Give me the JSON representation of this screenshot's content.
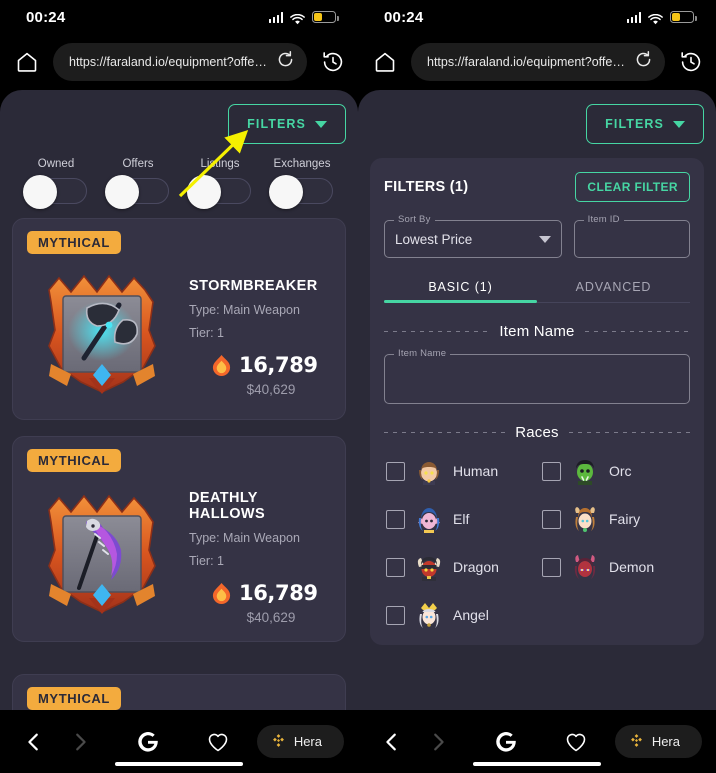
{
  "status_bar": {
    "time": "00:24",
    "signal_icon": "cellular-bars-icon",
    "wifi_icon": "wifi-icon",
    "battery_icon": "battery-low-icon"
  },
  "browser": {
    "home_icon": "home-icon",
    "url": "https://faraland.io/equipment?offer...",
    "reload_icon": "reload-icon",
    "history_icon": "history-icon"
  },
  "left_pane": {
    "filters_button": {
      "label": "FILTERS",
      "caret_icon": "chevron-down-icon",
      "accent": "#46d6a3"
    },
    "toggles": [
      {
        "label": "Owned",
        "state": "off"
      },
      {
        "label": "Offers",
        "state": "off"
      },
      {
        "label": "Listings",
        "state": "off"
      },
      {
        "label": "Exchanges",
        "state": "off"
      }
    ],
    "items": [
      {
        "rarity": "MYTHICAL",
        "name": "STORMBREAKER",
        "type": "Type: Main Weapon",
        "tier": "Tier: 1",
        "price": "16,789",
        "usd": "$40,629",
        "currency_icon": "flame-token-icon",
        "art": "stormbreaker-axe"
      },
      {
        "rarity": "MYTHICAL",
        "name": "DEATHLY HALLOWS",
        "type": "Type: Main Weapon",
        "tier": "Tier: 1",
        "price": "16,789",
        "usd": "$40,629",
        "currency_icon": "flame-token-icon",
        "art": "deathly-hallows-scythe"
      }
    ],
    "annotation": {
      "type": "arrow",
      "color": "#f5f000",
      "points_to": "filters-button"
    }
  },
  "right_pane": {
    "filters_button": {
      "label": "FILTERS",
      "caret_icon": "chevron-down-icon"
    },
    "panel": {
      "title": "FILTERS (1)",
      "clear_label": "CLEAR FILTER",
      "sort_by": {
        "legend": "Sort By",
        "value": "Lowest Price",
        "caret_icon": "chevron-down-icon"
      },
      "item_id": {
        "legend": "Item ID",
        "value": ""
      },
      "tabs": [
        {
          "label": "BASIC (1)",
          "active": true
        },
        {
          "label": "ADVANCED",
          "active": false
        }
      ],
      "item_name_section": {
        "title": "Item Name",
        "field_legend": "Item Name",
        "value": ""
      },
      "races_section": {
        "title": "Races",
        "races": [
          {
            "label": "Human",
            "avatar": "human-avatar-icon",
            "checked": false
          },
          {
            "label": "Orc",
            "avatar": "orc-avatar-icon",
            "checked": false
          },
          {
            "label": "Elf",
            "avatar": "elf-avatar-icon",
            "checked": false
          },
          {
            "label": "Fairy",
            "avatar": "fairy-avatar-icon",
            "checked": false
          },
          {
            "label": "Dragon",
            "avatar": "dragon-avatar-icon",
            "checked": false
          },
          {
            "label": "Demon",
            "avatar": "demon-avatar-icon",
            "checked": false
          },
          {
            "label": "Angel",
            "avatar": "angel-avatar-icon",
            "checked": false
          }
        ]
      }
    }
  },
  "bottom_nav": {
    "back_icon": "chevron-left-icon",
    "forward_icon": "chevron-right-icon",
    "google_icon": "google-g-icon",
    "shield_icon": "heart-shield-icon",
    "wallet_label": "Hera",
    "wallet_icon": "binance-icon"
  }
}
